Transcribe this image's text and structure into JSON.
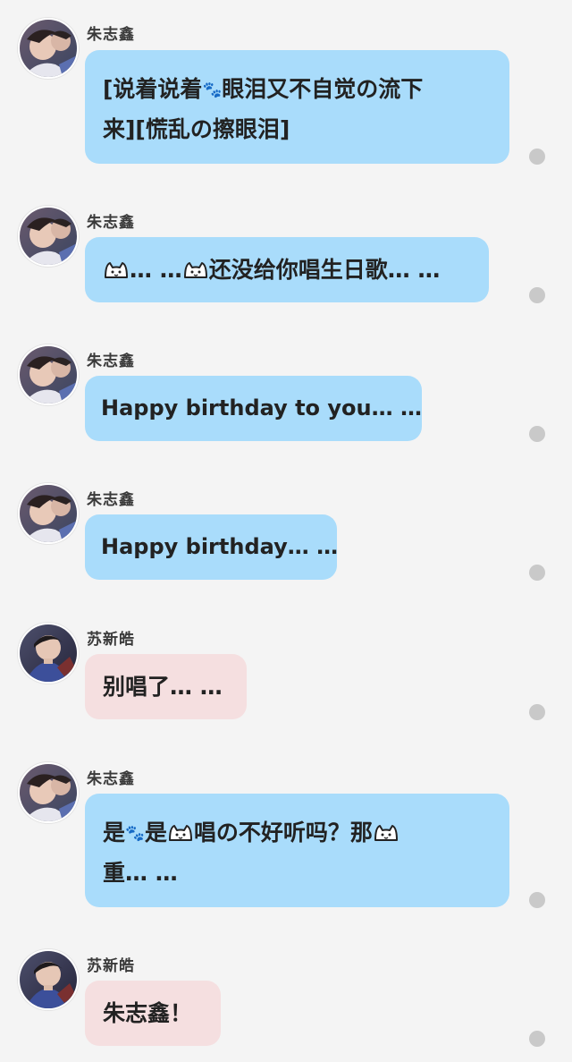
{
  "colors": {
    "background": "#f4f4f4",
    "bubble_zhu": "#a9dcfb",
    "bubble_su": "#f5dfe0",
    "status_dot": "#c9c9c9"
  },
  "messages": [
    {
      "sender": "朱志鑫",
      "line1a": "[说着说着",
      "line1b": "眼泪又不自觉の流下",
      "line2": "来][慌乱の擦眼泪]"
    },
    {
      "sender": "朱志鑫",
      "part_a": "… …",
      "part_b": "还没给你唱生日歌… …"
    },
    {
      "sender": "朱志鑫",
      "text": "Happy birthday to you… …"
    },
    {
      "sender": "朱志鑫",
      "text": "Happy birthday… …"
    },
    {
      "sender": "苏新皓",
      "text": "别唱了… …"
    },
    {
      "sender": "朱志鑫",
      "line1a": "是",
      "line1b": "是",
      "line1c": "唱の不好听吗？那",
      "line2": "重… …"
    },
    {
      "sender": "苏新皓",
      "text": "朱志鑫！"
    }
  ]
}
